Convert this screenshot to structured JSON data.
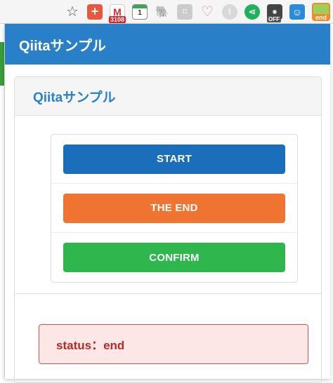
{
  "toolbar": {
    "gmail_count": "3108",
    "calendar_day": "1",
    "off_label": "OFF",
    "end_label": "end"
  },
  "popup": {
    "navbar_title": "Qiitaサンプル",
    "panel_title": "Qiitaサンプル",
    "buttons": {
      "start": "START",
      "end": "THE END",
      "confirm": "CONFIRM"
    },
    "status_text": "status：end"
  },
  "colors": {
    "primary": "#2a80c8",
    "start": "#1b6fba",
    "end": "#ef7432",
    "confirm": "#2fb64c",
    "alert_bg": "#fde6e6",
    "alert_text": "#b52b27"
  }
}
